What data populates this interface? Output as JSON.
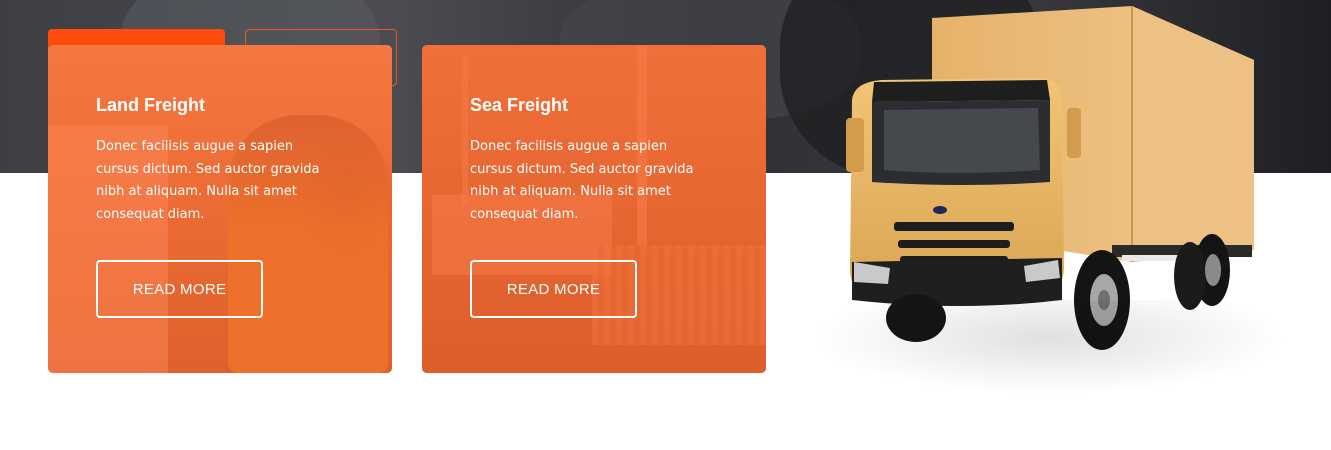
{
  "cards": [
    {
      "title": "Land Freight",
      "description": "Donec facilisis augue a sapien cursus dictum. Sed auctor gravida nibh at aliquam. Nulla sit amet consequat diam.",
      "button_label": "READ MORE"
    },
    {
      "title": "Sea Freight",
      "description": "Donec facilisis augue a sapien cursus dictum. Sed auctor gravida nibh at aliquam. Nulla sit amet consequat diam.",
      "button_label": "READ MORE"
    }
  ],
  "colors": {
    "accent": "#ff4c0d",
    "card_overlay": "#ff6428",
    "truck_body": "#e8b56a",
    "dark_band": "#3a3b40"
  },
  "icons": {
    "truck": "delivery-truck-illustration"
  }
}
